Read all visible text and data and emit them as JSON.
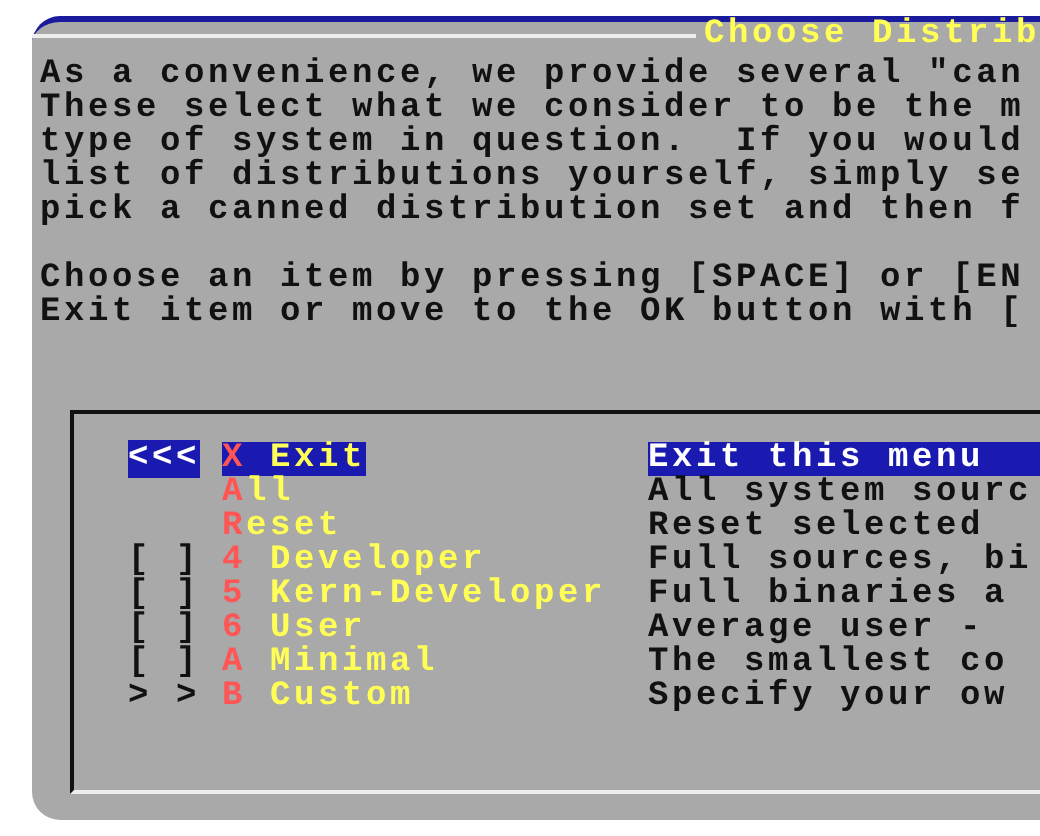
{
  "dialog": {
    "title": "Choose Distrib",
    "intro": [
      "As a convenience, we provide several \"can",
      "These select what we consider to be the m",
      "type of system in question.  If you would",
      "list of distributions yourself, simply se",
      "pick a canned distribution set and then f"
    ],
    "help": [
      "Choose an item by pressing [SPACE] or [EN",
      "Exit item or move to the OK button with ["
    ],
    "menu": [
      {
        "marker": "<<<",
        "key": "X",
        "label": "Exit",
        "description": "Exit this menu",
        "selected": true
      },
      {
        "key": "A",
        "label": "ll",
        "joined": true,
        "description": "All system sourc",
        "selected": false
      },
      {
        "key": "R",
        "label": "eset",
        "joined": true,
        "description": "Reset selected",
        "selected": false
      },
      {
        "marker": "[ ]",
        "key": "4",
        "label": "Developer",
        "description": "Full sources, bi",
        "selected": false
      },
      {
        "marker": "[ ]",
        "key": "5",
        "label": "Kern-Developer",
        "description": "Full binaries a",
        "selected": false
      },
      {
        "marker": "[ ]",
        "key": "6",
        "label": "User",
        "description": "Average user -",
        "selected": false
      },
      {
        "marker": "[ ]",
        "key": "A",
        "label": "Minimal",
        "description": "The smallest co",
        "selected": false
      },
      {
        "marker": "> >",
        "key": "B",
        "label": "Custom",
        "description": "Specify your ow",
        "selected": false
      }
    ]
  }
}
